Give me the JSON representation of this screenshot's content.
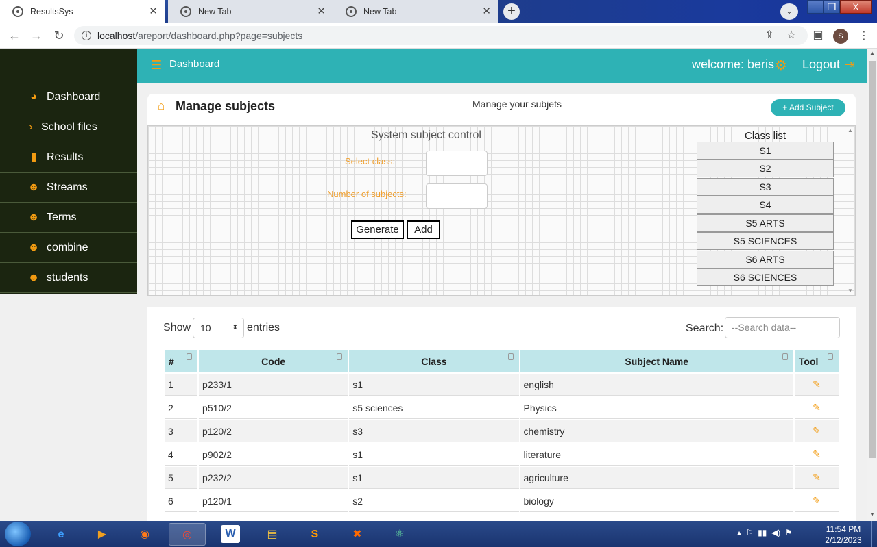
{
  "browser": {
    "tabs": [
      {
        "title": "ResultsSys",
        "active": true
      },
      {
        "title": "New Tab",
        "active": false
      },
      {
        "title": "New Tab",
        "active": false
      }
    ],
    "new_tab_symbol": "+",
    "url_host": "localhost",
    "url_path": "/areport/dashboard.php?page=subjects",
    "profile_initial": "S",
    "window_controls": {
      "minimize": "—",
      "maximize": "❐",
      "close": "X"
    },
    "icons": [
      "back-arrow-icon",
      "forward-arrow-icon",
      "reload-icon",
      "info-icon",
      "share-icon",
      "star-icon",
      "side-panel-icon",
      "menu-dots-icon"
    ]
  },
  "topbar": {
    "brand": "Dashboard",
    "welcome": "welcome: beris",
    "logout": "Logout",
    "color": "#2eb2b5",
    "accent": "#f39c12"
  },
  "sidebar": {
    "items": [
      {
        "label": "Dashboard",
        "icon": "dashboard-gauge-icon"
      },
      {
        "label": "School files",
        "icon": "chevron-right-icon"
      },
      {
        "label": "Results",
        "icon": "file-icon"
      },
      {
        "label": "Streams",
        "icon": "users-icon"
      },
      {
        "label": "Terms",
        "icon": "users-icon"
      },
      {
        "label": "combine",
        "icon": "users-icon"
      },
      {
        "label": "students",
        "icon": "users-icon"
      }
    ]
  },
  "manage": {
    "title": "Manage subjects",
    "subtitle": "Manage your subjets",
    "add_button": "+ Add Subject",
    "control_title": "System subject control",
    "select_class_label": "Select class:",
    "num_subjects_label": "Number of subjects:",
    "generate_button": "Generate",
    "add_small_button": "Add",
    "class_list_title": "Class list",
    "classes": [
      "S1",
      "S2",
      "S3",
      "S4",
      "S5 ARTS",
      "S5 SCIENCES",
      "S6 ARTS",
      "S6 SCIENCES"
    ]
  },
  "table_controls": {
    "show_label": "Show",
    "entries_value": "10",
    "entries_label": "entries",
    "search_label": "Search:",
    "search_placeholder": "--Search data--"
  },
  "table": {
    "headers": [
      "#",
      "Code",
      "Class",
      "Subject Name",
      "Tool"
    ],
    "rows": [
      {
        "num": "1",
        "code": "p233/1",
        "class": "s1",
        "subject": "english"
      },
      {
        "num": "2",
        "code": "p510/2",
        "class": "s5 sciences",
        "subject": "Physics"
      },
      {
        "num": "3",
        "code": "p120/2",
        "class": "s3",
        "subject": "chemistry"
      },
      {
        "num": "4",
        "code": "p902/2",
        "class": "s1",
        "subject": "literature"
      },
      {
        "num": "5",
        "code": "p232/2",
        "class": "s1",
        "subject": "agriculture"
      },
      {
        "num": "6",
        "code": "p120/1",
        "class": "s2",
        "subject": "biology"
      }
    ]
  },
  "taskbar": {
    "apps": [
      "internet-explorer-icon",
      "media-player-icon",
      "firefox-icon",
      "chrome-icon",
      "word-icon",
      "file-explorer-icon",
      "sublime-icon",
      "xampp-icon",
      "atom-icon"
    ],
    "time": "11:54 PM",
    "date": "2/12/2023"
  }
}
